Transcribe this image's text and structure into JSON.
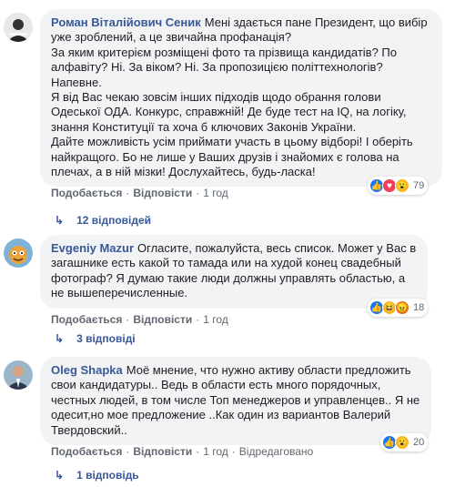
{
  "comments": [
    {
      "author": "Роман Віталійович Сеник",
      "text": "Мені здається пане Президент, що вибір уже зроблений, а це звичайна профанація?\nЗа яким критерієм розміщені фото та прізвища кандидатів? По алфавіту? Ні. За віком? Ні. За пропозицією політтехнологів? Напевне.\nЯ від Вас чекаю зовсім інших підходів щодо обрання голови Одеської ОДА. Конкурс, справжній! Де буде тест на IQ, на логіку, знання Конституції та хоча б ключових Законів України.\nДайте можливість усім приймати участь в цьому відборі! І оберіть найкращого. Бо не лише у Ваших друзів і знайомих є голова на плечах, а в ній мізки! Дослухайтесь, будь-ласка!",
      "like_label": "Подобається",
      "reply_label": "Відповісти",
      "time": "1 год",
      "edited": "",
      "reaction_count": "79",
      "reaction_icons": [
        "like-icon",
        "love-icon",
        "wow-icon"
      ],
      "replies": "12 відповідей"
    },
    {
      "author": "Evgeniy Mazur",
      "text": "Огласите, пожалуйста, весь список. Может у Вас в загашнике есть какой то тамада или на худой конец свадебный фотограф? Я думаю такие люди должны управлять областью, а не вышеперечисленные.",
      "like_label": "Подобається",
      "reply_label": "Відповісти",
      "time": "1 год",
      "edited": "",
      "reaction_count": "18",
      "reaction_icons": [
        "like-icon",
        "haha-icon",
        "angry-icon"
      ],
      "replies": "3 відповіді"
    },
    {
      "author": "Oleg Shapka",
      "text": "Моё мнение, что нужно активу области предложить свои кандидатуры.. Ведь в области есть много порядочных, честных людей, в том числе Топ менеджеров и управленцев.. Я не одесит,но мое предложение ..Как один из вариантов Валерий Твердовский..",
      "like_label": "Подобається",
      "reply_label": "Відповісти",
      "time": "1 год",
      "edited": "Відредаговано",
      "reaction_count": "20",
      "reaction_icons": [
        "like-icon",
        "wow-icon"
      ],
      "replies": "1 відповідь"
    }
  ],
  "colors": {
    "link": "#385898",
    "bubble": "#f2f3f5",
    "meta": "#606770"
  }
}
